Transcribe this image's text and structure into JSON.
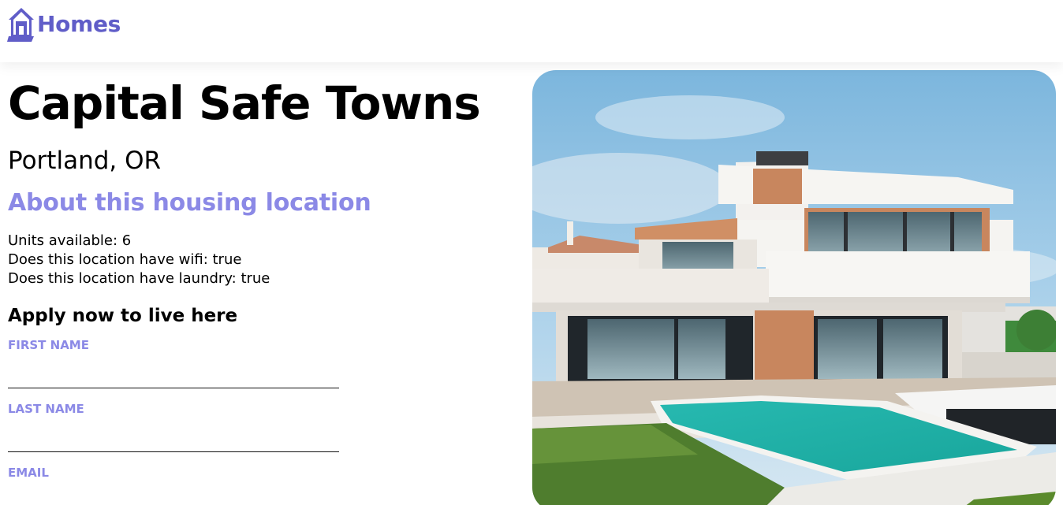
{
  "header": {
    "brand_label": "Homes",
    "brand_icon": "house-icon",
    "brand_color": "#605dc8"
  },
  "listing": {
    "name": "Capital Safe Towns",
    "location": "Portland, OR",
    "about_heading": "About this housing location",
    "features": [
      "Units available: 6",
      "Does this location have wifi: true",
      "Does this location have laundry: true"
    ],
    "photo_icon": "house-photo"
  },
  "form": {
    "heading": "Apply now to live here",
    "first_name_label": "FIRST NAME",
    "first_name_value": "",
    "last_name_label": "LAST NAME",
    "last_name_value": "",
    "email_label": "EMAIL",
    "email_value": ""
  },
  "colors": {
    "accent": "#8b89e6",
    "primary": "#605dc8"
  }
}
